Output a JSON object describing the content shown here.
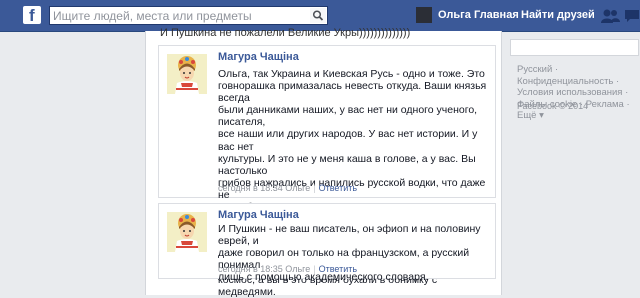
{
  "topbar": {
    "logo": "f",
    "search_placeholder": "Ищите людей, места или предметы",
    "user_name": "Ольга",
    "home": "Главная",
    "find_friends": "Найти друзей",
    "accent": "#3b5998"
  },
  "post": {
    "header_text": "И Пушкина не пожалели Великие Укры))))))))))))))"
  },
  "comments": [
    {
      "author": "Магура Чащіна",
      "text": "Ольга, так Украина и Киевская Русь - одно и тоже. Это\nговнорашка примазалась невесть откуда. Ваши князья всегда\nбыли данниками наших, у вас нет ни одного ученого, писателя,\nвсе наши или других народов. У вас нет истории. И у вас нет\nкультуры. И это не у меня каша в голове, а у вас. Вы настолько\nгрибов нажрались и напились русской водки, что даже не\nспособны посмотреть возраст на странице, хотя он указан)))\nМы, украинцы, прямые наследники Руси, центр Европы, центр\nславянских земель и центр мира. Мы отправили человека в\nкосмос, а вы в это время бухали в обнимку с медведями.",
      "time": "сегодня в 18:34 Ольге",
      "reply": "Ответить"
    },
    {
      "author": "Магура Чащіна",
      "text": "И Пушкин - не ваш писатель, он эфиоп и на половину еврей, и\nдаже говорил он только на французском, а русский понимал\nлишь с помощью академического словаря.",
      "time": "сегодня в 18:35 Ольге",
      "reply": "Ответить"
    }
  ],
  "sidebar": {
    "links": "Русский · Конфиденциальность · Условия использования · Файлы cookie · Реклама · Ещё ▾",
    "copyright": "Facebook © 2014"
  }
}
